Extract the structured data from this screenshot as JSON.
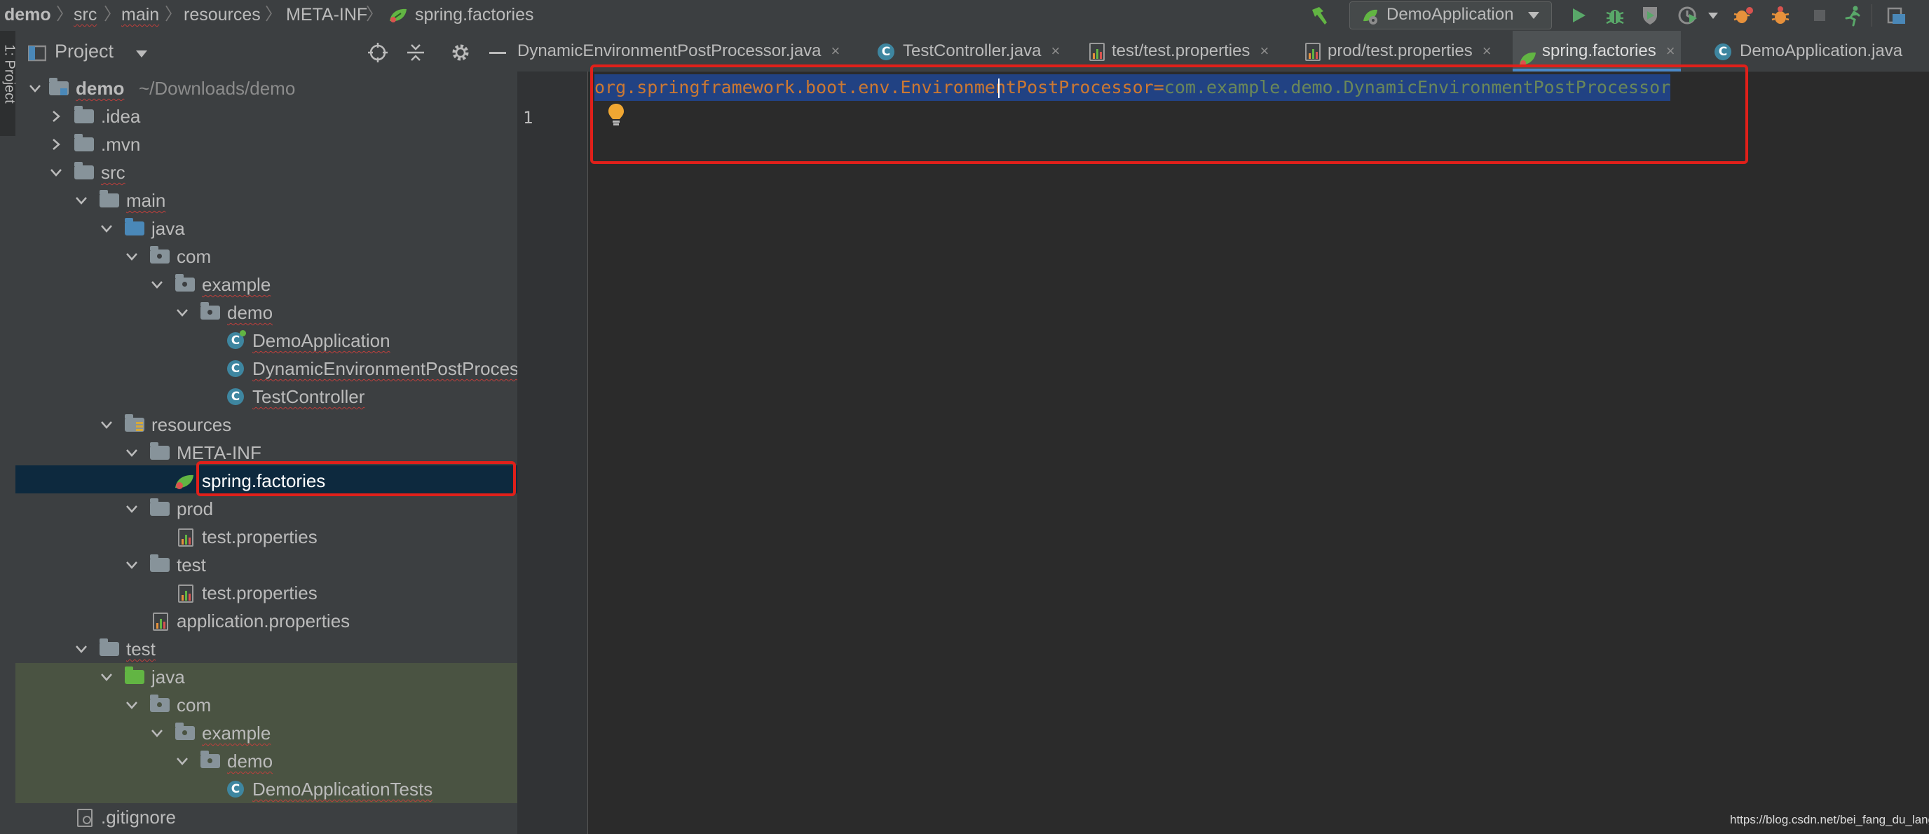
{
  "breadcrumb": [
    "demo",
    "src",
    "main",
    "resources",
    "META-INF",
    "spring.factories"
  ],
  "run_config": "DemoApplication",
  "project_panel": {
    "title": "Project",
    "side_tab": "1: Project"
  },
  "tree": {
    "root_name": "demo",
    "root_path": "~/Downloads/demo",
    "idea": ".idea",
    "mvn": ".mvn",
    "src": "src",
    "main": "main",
    "java": "java",
    "com": "com",
    "example": "example",
    "demo": "demo",
    "demo_application": "DemoApplication",
    "dynamic_epp": "DynamicEnvironmentPostProcessor",
    "test_controller": "TestController",
    "resources": "resources",
    "meta_inf": "META-INF",
    "spring_factories": "spring.factories",
    "prod": "prod",
    "test_properties": "test.properties",
    "test_dir": "test",
    "application_properties": "application.properties",
    "test": "test",
    "java2": "java",
    "com2": "com",
    "example2": "example",
    "demo2": "demo",
    "demo_application_tests": "DemoApplicationTests",
    "gitignore": ".gitignore"
  },
  "tabs": [
    {
      "label": "DynamicEnvironmentPostProcessor.java",
      "close": "×"
    },
    {
      "label": "TestController.java",
      "close": "×"
    },
    {
      "label": "test/test.properties",
      "close": "×"
    },
    {
      "label": "prod/test.properties",
      "close": "×"
    },
    {
      "label": "spring.factories",
      "close": "×",
      "active": true
    },
    {
      "label": "DemoApplication.java",
      "close": ""
    }
  ],
  "editor": {
    "line_number": "1",
    "key": "org.springframework.boot.env.EnvironmentPostProcessor",
    "equals": "=",
    "value": "com.example.demo.DynamicEnvironmentPostProcessor"
  },
  "watermark": "https://blog.csdn.net/bei_fang_du_lang",
  "colors": {
    "panel_bg": "#3c3f41",
    "editor_bg": "#2b2b2b",
    "selection": "#214283",
    "key_color": "#cc7832",
    "value_color": "#6a8759",
    "highlight_box": "#e0201a",
    "folder": "#87939a",
    "source_folder": "#4a88b8",
    "test_folder": "#62b543",
    "class_icon": "#3e86a0"
  }
}
